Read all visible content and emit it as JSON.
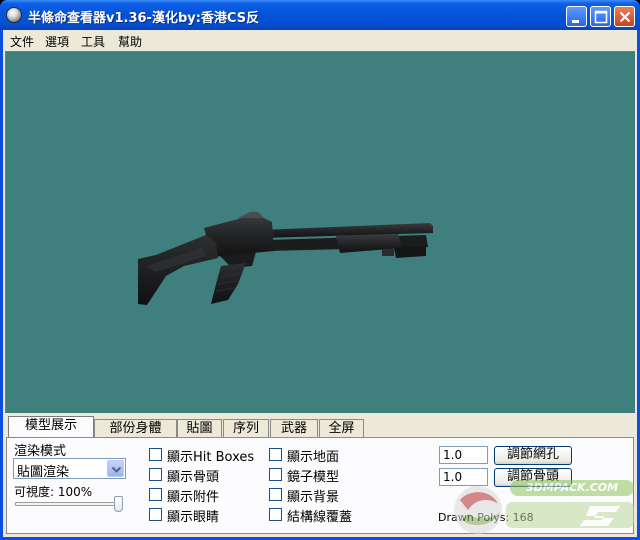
{
  "window": {
    "title": "半條命查看器v1.36-漢化by:香港CS反",
    "minimize_icon": "minimize-icon",
    "maximize_icon": "maximize-icon",
    "close_icon": "close-icon"
  },
  "menu": {
    "items": [
      "文件",
      "選項",
      "工具",
      "幫助"
    ]
  },
  "viewport": {
    "background": "#3f7f7e"
  },
  "tabs": [
    "模型展示",
    "部份身體",
    "貼圖",
    "序列",
    "武器",
    "全屏"
  ],
  "active_tab": "模型展示",
  "panel": {
    "render_mode_label": "渲染模式",
    "render_mode_value": "貼圖渲染",
    "visibility_label": "可視度: 100%",
    "visibility_value": 100,
    "checkboxes_col1": [
      "顯示Hit Boxes",
      "顯示骨頭",
      "顯示附件",
      "顯示眼睛"
    ],
    "checkboxes_col2": [
      "顯示地面",
      "鏡子模型",
      "顯示背景",
      "結構線覆蓋"
    ],
    "mesh_value": "1.0",
    "mesh_button": "調節網孔",
    "bone_value": "1.0",
    "bone_button": "調節骨頭",
    "drawn_polys": "Drawn Polys: 168"
  },
  "watermark": {
    "text": "3DMPACK.COM"
  },
  "colors": {
    "titlebar": "#0554d8",
    "viewport_bg": "#3f7f7e",
    "face": "#ece9d8"
  }
}
